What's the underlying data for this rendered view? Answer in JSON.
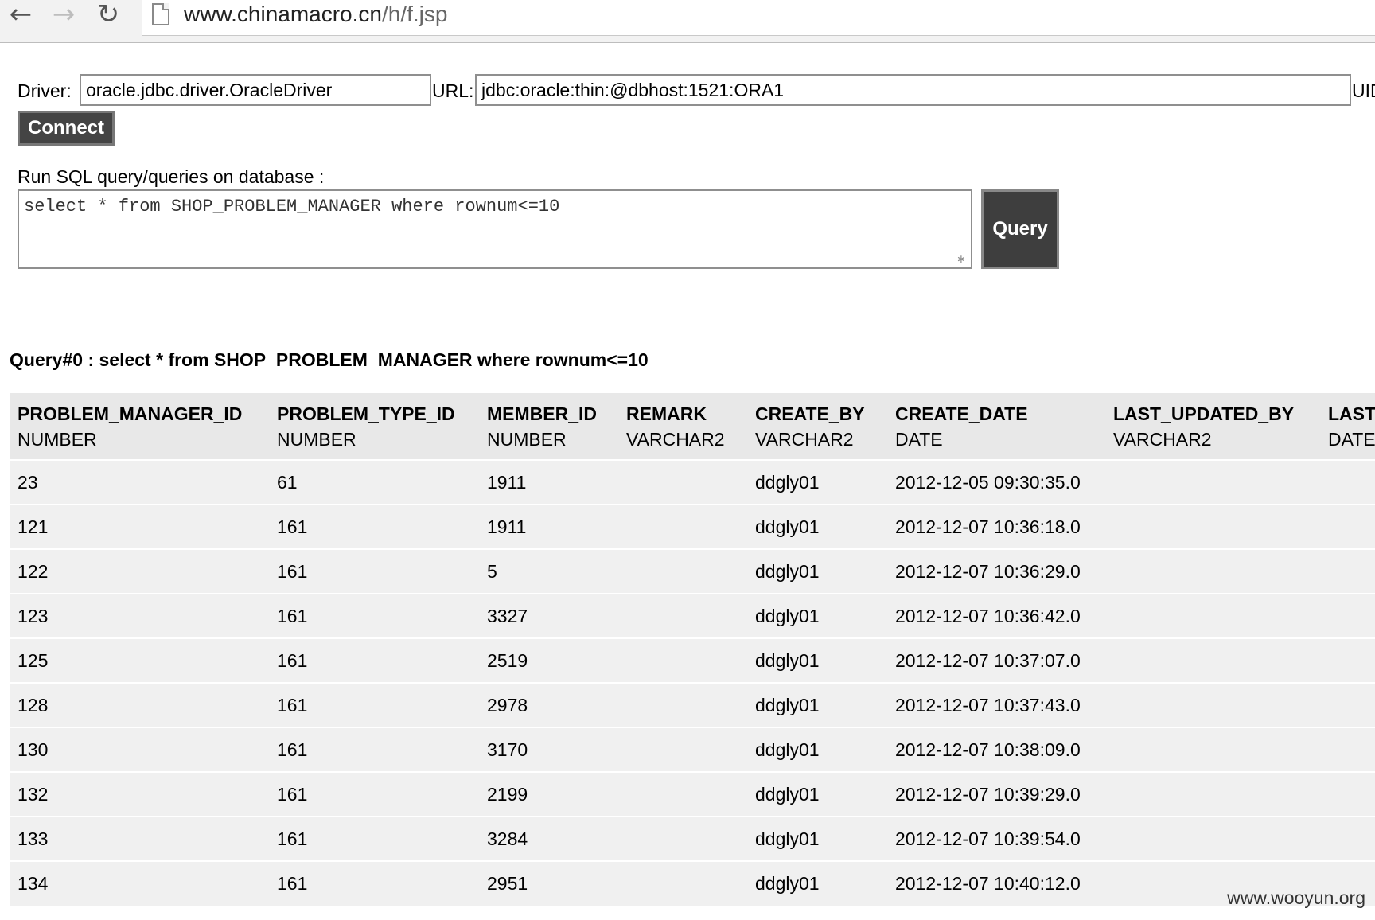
{
  "browser": {
    "url_host": "www.chinamacro.cn",
    "url_path": "/h/f.jsp",
    "back_icon": "back-arrow-icon",
    "forward_icon": "forward-arrow-icon",
    "reload_icon": "reload-icon",
    "page_icon": "page-icon"
  },
  "connection": {
    "driver_label": "Driver:",
    "driver_value": "oracle.jdbc.driver.OracleDriver",
    "url_label": "URL:",
    "url_value": "jdbc:oracle:thin:@dbhost:1521:ORA1",
    "uid_label": "UID",
    "connect_label": "Connect"
  },
  "sql": {
    "prompt": "Run SQL query/queries on database :",
    "query_text": "select * from SHOP_PROBLEM_MANAGER where rownum<=10",
    "query_button": "Query"
  },
  "result": {
    "title": "Query#0 : select * from SHOP_PROBLEM_MANAGER where rownum<=10",
    "columns": [
      {
        "name": "PROBLEM_MANAGER_ID",
        "type": "NUMBER"
      },
      {
        "name": "PROBLEM_TYPE_ID",
        "type": "NUMBER"
      },
      {
        "name": "MEMBER_ID",
        "type": "NUMBER"
      },
      {
        "name": "REMARK",
        "type": "VARCHAR2"
      },
      {
        "name": "CREATE_BY",
        "type": "VARCHAR2"
      },
      {
        "name": "CREATE_DATE",
        "type": "DATE"
      },
      {
        "name": "LAST_UPDATED_BY",
        "type": "VARCHAR2"
      },
      {
        "name": "LAST",
        "type": "DATE"
      }
    ],
    "rows": [
      [
        "23",
        "61",
        "1911",
        "",
        "ddgly01",
        "2012-12-05 09:30:35.0",
        "",
        ""
      ],
      [
        "121",
        "161",
        "1911",
        "",
        "ddgly01",
        "2012-12-07 10:36:18.0",
        "",
        ""
      ],
      [
        "122",
        "161",
        "5",
        "",
        "ddgly01",
        "2012-12-07 10:36:29.0",
        "",
        ""
      ],
      [
        "123",
        "161",
        "3327",
        "",
        "ddgly01",
        "2012-12-07 10:36:42.0",
        "",
        ""
      ],
      [
        "125",
        "161",
        "2519",
        "",
        "ddgly01",
        "2012-12-07 10:37:07.0",
        "",
        ""
      ],
      [
        "128",
        "161",
        "2978",
        "",
        "ddgly01",
        "2012-12-07 10:37:43.0",
        "",
        ""
      ],
      [
        "130",
        "161",
        "3170",
        "",
        "ddgly01",
        "2012-12-07 10:38:09.0",
        "",
        ""
      ],
      [
        "132",
        "161",
        "2199",
        "",
        "ddgly01",
        "2012-12-07 10:39:29.0",
        "",
        ""
      ],
      [
        "133",
        "161",
        "3284",
        "",
        "ddgly01",
        "2012-12-07 10:39:54.0",
        "",
        ""
      ],
      [
        "134",
        "161",
        "2951",
        "",
        "ddgly01",
        "2012-12-07 10:40:12.0",
        "",
        ""
      ]
    ]
  },
  "watermark": "www.wooyun.org"
}
